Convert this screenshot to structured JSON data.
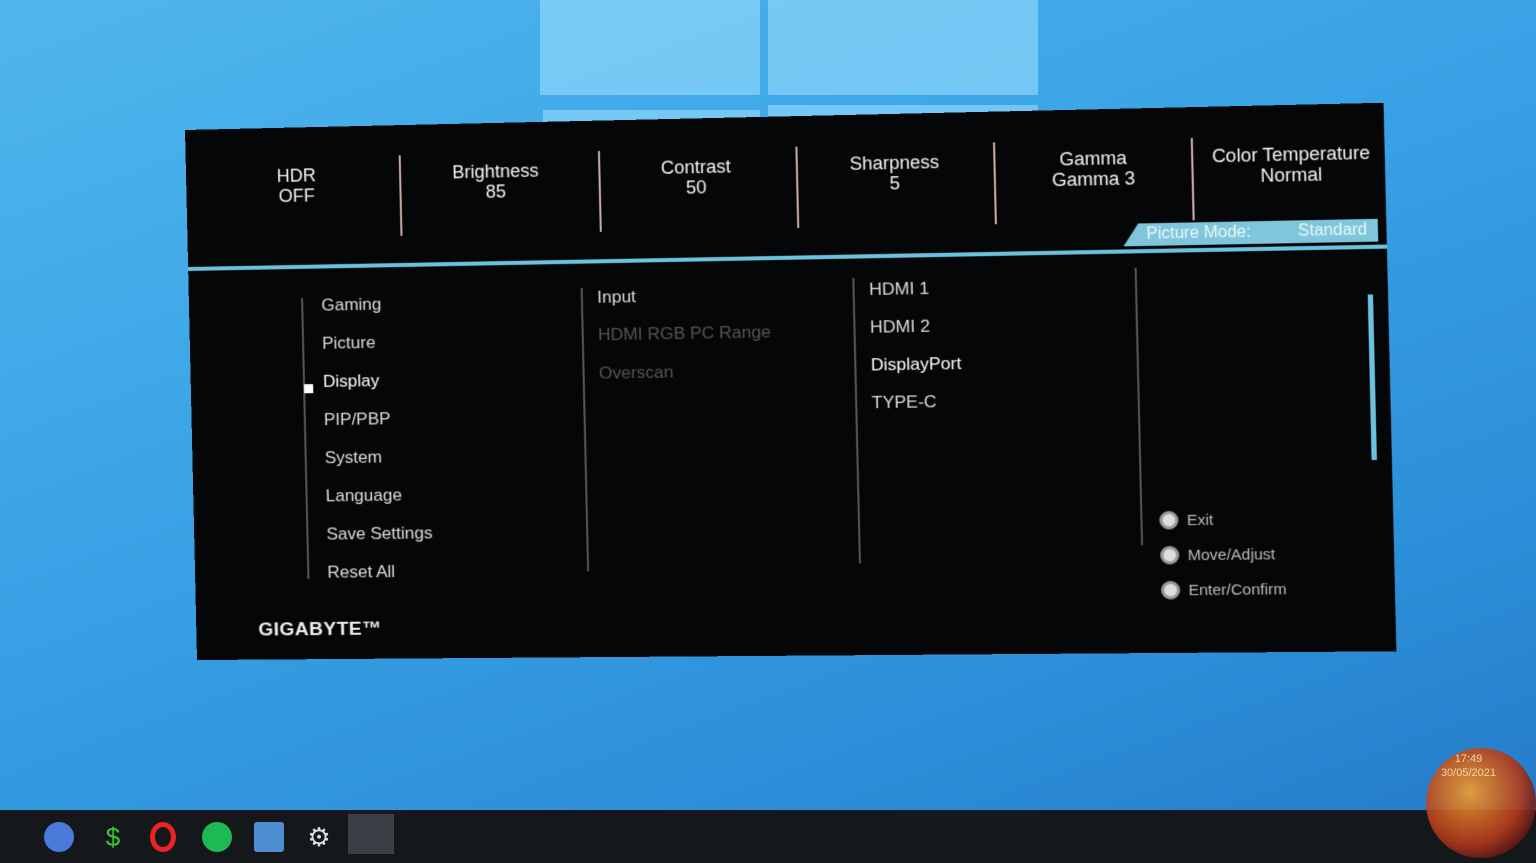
{
  "top_settings": [
    {
      "label": "HDR",
      "value": "OFF"
    },
    {
      "label": "Brightness",
      "value": "85"
    },
    {
      "label": "Contrast",
      "value": "50"
    },
    {
      "label": "Sharpness",
      "value": "5"
    },
    {
      "label": "Gamma",
      "value": "Gamma 3"
    },
    {
      "label": "Color Temperature",
      "value": "Normal"
    }
  ],
  "picture_mode": {
    "label": "Picture Mode:",
    "value": "Standard"
  },
  "main_menu": [
    "Gaming",
    "Picture",
    "Display",
    "PIP/PBP",
    "System",
    "Language",
    "Save Settings",
    "Reset All"
  ],
  "main_menu_selected": "Display",
  "sub_menu": [
    {
      "label": "Input",
      "enabled": true
    },
    {
      "label": "HDMI RGB PC Range",
      "enabled": false
    },
    {
      "label": "Overscan",
      "enabled": false
    }
  ],
  "options": [
    "HDMI 1",
    "HDMI 2",
    "DisplayPort",
    "TYPE-C"
  ],
  "options_selected": "DisplayPort",
  "hints": [
    {
      "icon": "joystick-icon",
      "label": "Exit"
    },
    {
      "icon": "joystick-icon",
      "label": "Move/Adjust"
    },
    {
      "icon": "joystick-icon",
      "label": "Enter/Confirm"
    }
  ],
  "brand": "GIGABYTE™",
  "accent_color": "#6bc1de",
  "clock": {
    "time": "17:49",
    "date": "30/05/2021"
  }
}
